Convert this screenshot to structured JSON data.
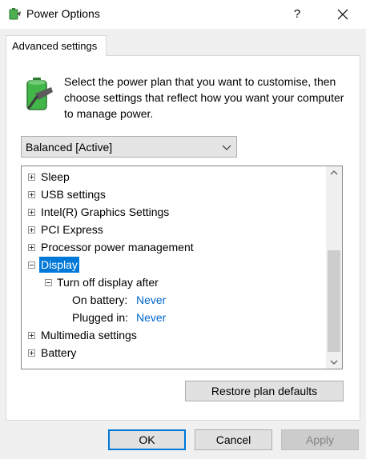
{
  "window": {
    "title": "Power Options",
    "help_label": "?",
    "close_label": "✕"
  },
  "tab": {
    "label": "Advanced settings"
  },
  "description": "Select the power plan that you want to customise, then choose settings that reflect how you want your computer to manage power.",
  "plan_select": {
    "selected": "Balanced [Active]"
  },
  "tree": {
    "items": [
      {
        "label": "Sleep"
      },
      {
        "label": "USB settings"
      },
      {
        "label": "Intel(R) Graphics Settings"
      },
      {
        "label": "PCI Express"
      },
      {
        "label": "Processor power management"
      },
      {
        "label": "Display"
      },
      {
        "label": "Turn off display after"
      },
      {
        "label": "On battery:",
        "value": "Never"
      },
      {
        "label": "Plugged in:",
        "value": "Never"
      },
      {
        "label": "Multimedia settings"
      },
      {
        "label": "Battery"
      }
    ]
  },
  "buttons": {
    "restore": "Restore plan defaults",
    "ok": "OK",
    "cancel": "Cancel",
    "apply": "Apply"
  },
  "colors": {
    "selection": "#0078d7",
    "value_link": "#0066cc",
    "battery_green": "#3cb043"
  }
}
